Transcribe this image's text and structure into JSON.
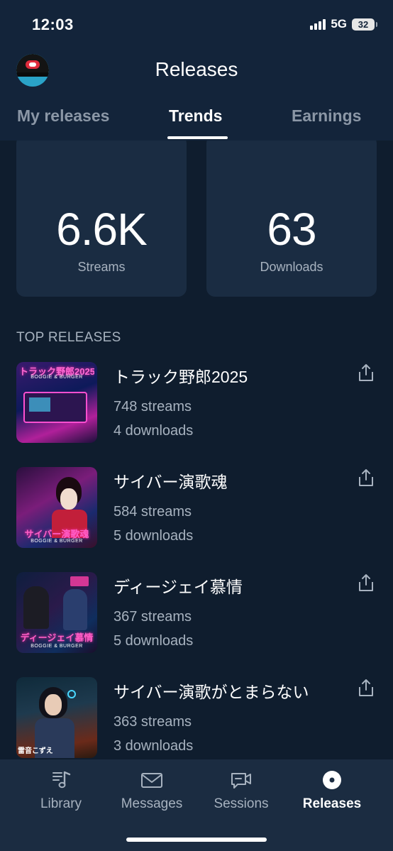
{
  "status_bar": {
    "time": "12:03",
    "network": "5G",
    "battery": "32"
  },
  "header": {
    "title": "Releases"
  },
  "tabs": [
    {
      "label": "My releases",
      "active": false
    },
    {
      "label": "Trends",
      "active": true
    },
    {
      "label": "Earnings",
      "active": false
    }
  ],
  "stats": [
    {
      "value": "6.6K",
      "label": "Streams"
    },
    {
      "value": "63",
      "label": "Downloads"
    }
  ],
  "section_title": "TOP RELEASES",
  "releases": [
    {
      "title": "トラック野郎2025",
      "streams": "748 streams",
      "downloads": "4 downloads",
      "cover_text": "トラック野郎2025",
      "cover_sub": "BOGGIE & BURGER"
    },
    {
      "title": "サイバー演歌魂",
      "streams": "584 streams",
      "downloads": "5 downloads",
      "cover_text": "サイバー演歌魂",
      "cover_sub": "BOGGIE & BURGER"
    },
    {
      "title": "ディージェイ慕情",
      "streams": "367 streams",
      "downloads": "5 downloads",
      "cover_text": "ディージェイ慕情",
      "cover_sub": "BOGGIE & BURGER"
    },
    {
      "title": "サイバー演歌がとまらない",
      "streams": "363 streams",
      "downloads": "3 downloads",
      "cover_text": "雷音こずえ",
      "cover_sub": ""
    }
  ],
  "nav": [
    {
      "label": "Library",
      "icon": "music-note-icon",
      "active": false
    },
    {
      "label": "Messages",
      "icon": "envelope-icon",
      "active": false
    },
    {
      "label": "Sessions",
      "icon": "video-chat-icon",
      "active": false
    },
    {
      "label": "Releases",
      "icon": "disc-icon",
      "active": true
    }
  ],
  "colors": {
    "background": "#0f1d2e",
    "card": "#1a2c42",
    "muted_text": "#a7b2bf",
    "accent_white": "#ffffff"
  }
}
